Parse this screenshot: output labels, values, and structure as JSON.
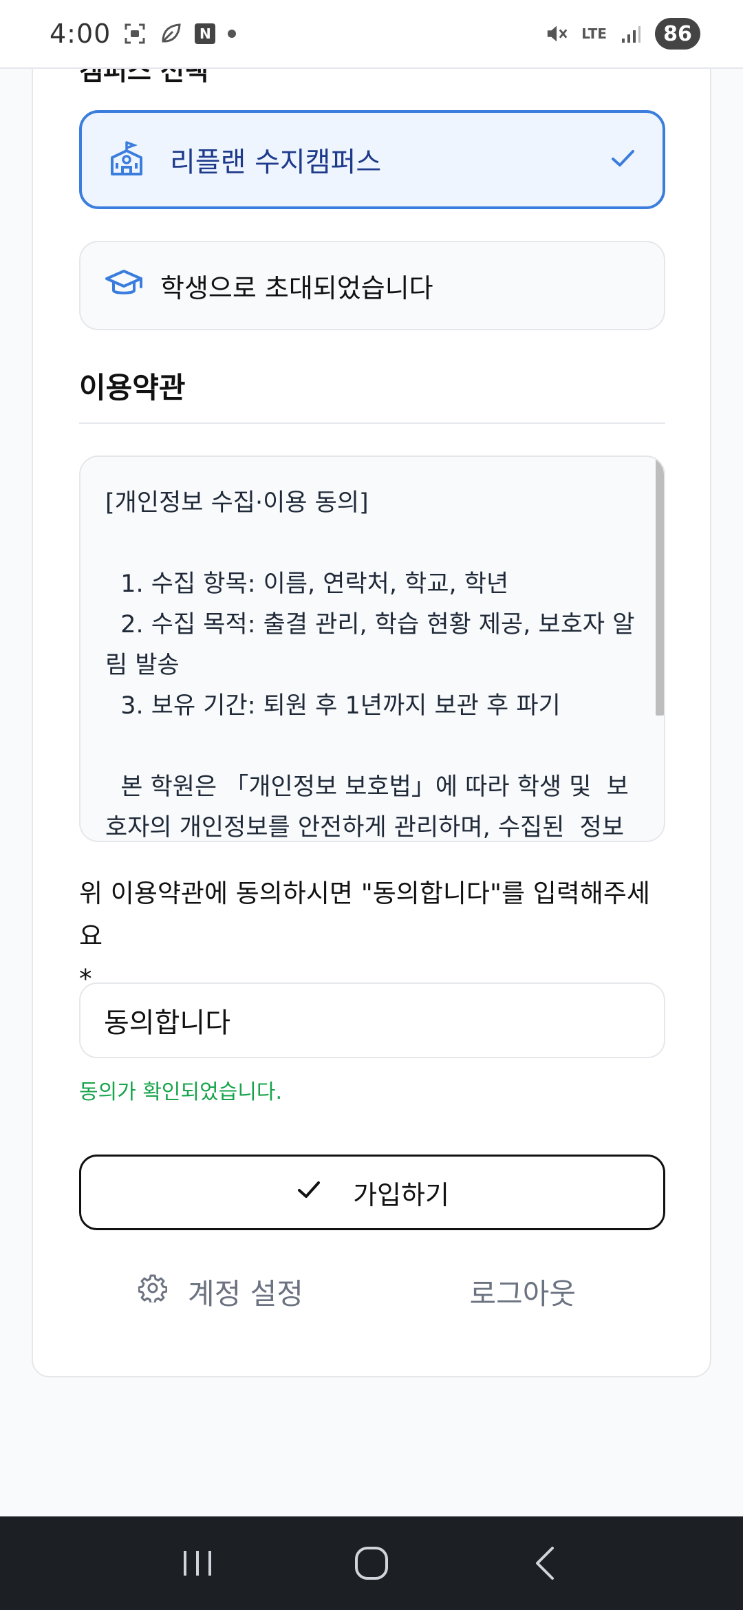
{
  "status": {
    "time": "4:00",
    "n_badge": "N",
    "network": "LTE",
    "battery": "86"
  },
  "section_partial": "캠퍼스 선택",
  "campus": {
    "name": "리플랜 수지캠퍼스",
    "selected": true
  },
  "invite": {
    "text": "학생으로 초대되었습니다"
  },
  "terms": {
    "heading": "이용약관",
    "body": "[개인정보 수집·이용 동의]\n\n  1. 수집 항목: 이름, 연락처, 학교, 학년\n  2. 수집 목적: 출결 관리, 학습 현황 제공, 보호자 알림 발송\n  3. 보유 기간: 퇴원 후 1년까지 보관 후 파기\n\n  본 학원은 「개인정보 보호법」에 따라 학생 및  보호자의 개인정보를 안전하게 관리하며, 수집된  정보"
  },
  "agreement": {
    "instruction": "위 이용약관에 동의하시면 \"동의합니다\"를 입력해주세요",
    "required_mark": "*",
    "value": "동의합니다",
    "confirmation": "동의가 확인되었습니다."
  },
  "actions": {
    "signup_label": "가입하기",
    "settings_label": "계정 설정",
    "logout_label": "로그아웃"
  },
  "colors": {
    "accent": "#3b7ddd",
    "success": "#16a34a",
    "muted": "#6b7280"
  }
}
